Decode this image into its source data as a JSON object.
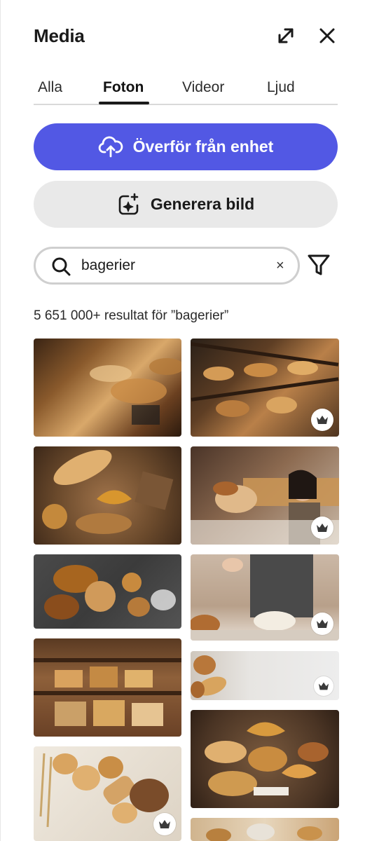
{
  "panel": {
    "title": "Media"
  },
  "header_icons": [
    "expand-icon",
    "close-icon"
  ],
  "tabs": [
    {
      "label": "Alla",
      "active": false
    },
    {
      "label": "Foton",
      "active": true
    },
    {
      "label": "Videor",
      "active": false
    },
    {
      "label": "Ljud",
      "active": false
    }
  ],
  "upload_button": {
    "label": "Överför från enhet",
    "icon": "cloud-upload-icon",
    "color": "#5258e4"
  },
  "generate_button": {
    "label": "Generera bild",
    "icon": "sparkle-image-icon"
  },
  "search": {
    "value": "bagerier",
    "clear_symbol": "×"
  },
  "results": {
    "count_text": "5 651 000+ resultat för ”bagerier”"
  },
  "images": [
    {
      "subject": "bakery-display-shelves",
      "premium": false
    },
    {
      "subject": "bread-shelves-bakery",
      "premium": true
    },
    {
      "subject": "croissants-and-bread-on-burlap",
      "premium": false
    },
    {
      "subject": "baker-woman-handing-bread",
      "premium": true
    },
    {
      "subject": "assorted-bread-dark-background",
      "premium": false
    },
    {
      "subject": "baker-kneading-dough-flour",
      "premium": true
    },
    {
      "subject": "bread-baskets-shelves",
      "premium": false
    },
    {
      "subject": "bread-on-white-wood",
      "premium": true
    },
    {
      "subject": "bread-rolls-with-wheat",
      "premium": true
    },
    {
      "subject": "croissants-pastries-on-table",
      "premium": false
    },
    {
      "subject": "bakery-partial",
      "premium": false
    }
  ]
}
